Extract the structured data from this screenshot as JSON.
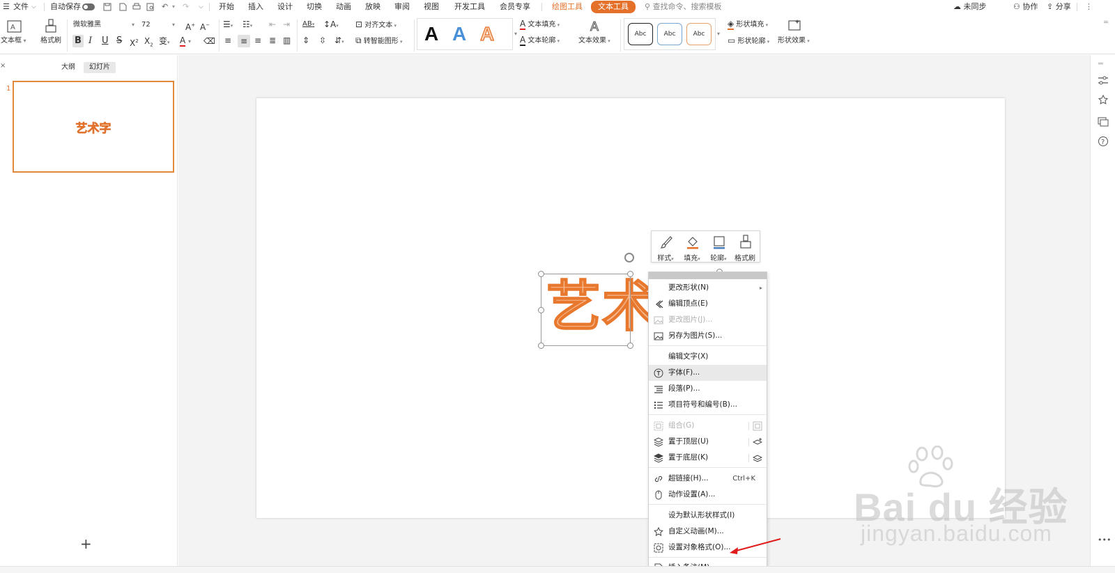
{
  "menubar": {
    "file": "文件",
    "autosave": "自动保存",
    "tabs": [
      "开始",
      "插入",
      "设计",
      "切换",
      "动画",
      "放映",
      "审阅",
      "视图",
      "开发工具",
      "会员专享"
    ],
    "draw_tools": "绘图工具",
    "text_tools": "文本工具",
    "search_placeholder": "查找命令、搜索模板",
    "not_synced": "未同步",
    "collaborate": "协作",
    "share": "分享"
  },
  "ribbon": {
    "textbox": "文本框",
    "format_painter": "格式刷",
    "font_name": "微软雅黑",
    "font_size": "72",
    "align_text": "对齐文本",
    "smart_shape": "转智能图形",
    "text_fill": "文本填充",
    "text_outline": "文本轮廓",
    "text_effect": "文本效果",
    "shape_fill": "形状填充",
    "shape_outline": "形状轮廓",
    "shape_effect": "形状效果",
    "abc_sample": "Abc",
    "bigA": "A",
    "colors": {
      "accent": "#e5702a",
      "blue_a": "#4a90d9",
      "orange_a": "#f3a36b"
    }
  },
  "leftpanel": {
    "outline_tab": "大纲",
    "slides_tab": "幻灯片",
    "slide_number": "1",
    "thumb_text": "艺术字",
    "add_slide": "+"
  },
  "canvas": {
    "art_text": "艺术字"
  },
  "minitoolbar": {
    "style": "样式",
    "fill": "填充",
    "outline": "轮廓",
    "painter": "格式刷"
  },
  "context_menu": {
    "change_shape": "更改形状(N)",
    "edit_points": "编辑顶点(E)",
    "change_picture": "更改图片(J)...",
    "save_as_picture": "另存为图片(S)...",
    "edit_text": "编辑文字(X)",
    "font": "字体(F)...",
    "paragraph": "段落(P)...",
    "bullets": "项目符号和编号(B)...",
    "group": "组合(G)",
    "bring_front": "置于顶层(U)",
    "send_back": "置于底层(K)",
    "hyperlink": "超链接(H)...",
    "hyperlink_shortcut": "Ctrl+K",
    "action_settings": "动作设置(A)...",
    "default_style": "设为默认形状样式(I)",
    "custom_animation": "自定义动画(M)...",
    "format_object": "设置对象格式(O)...",
    "insert_note": "插入备注(M)"
  },
  "watermark": {
    "logo": "Bai du 经验",
    "url": "jingyan.baidu.com"
  }
}
